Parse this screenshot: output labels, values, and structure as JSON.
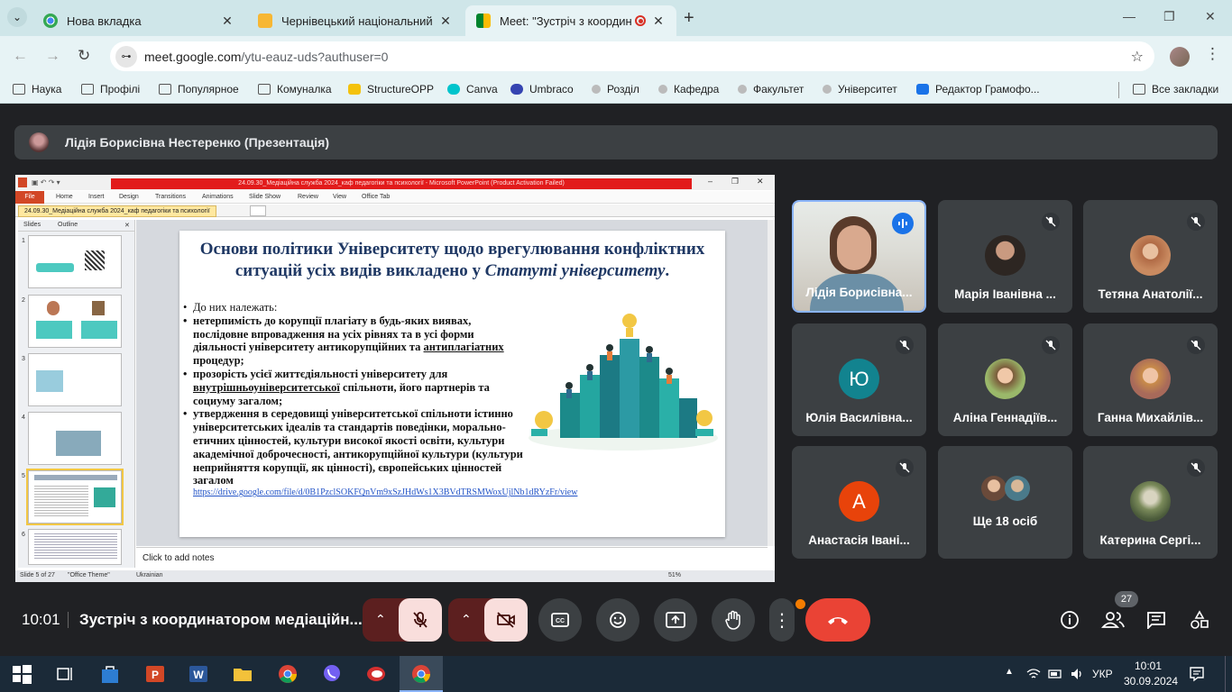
{
  "browser": {
    "tabs": [
      {
        "title": "Нова вкладка"
      },
      {
        "title": "Чернівецький національний у"
      },
      {
        "title": "Meet: \"Зустріч з координат"
      }
    ],
    "url_main": "meet.google.com",
    "url_path": "/ytu-eauz-uds?authuser=0",
    "bookmarks": [
      "Наука",
      "Профілі",
      "Популярное",
      "Комуналка",
      "StructureOPP",
      "Canva",
      "Umbraco",
      "Розділ",
      "Кафедра",
      "Факультет",
      "Університет",
      "Редактор Грамофо...",
      "Все закладки"
    ]
  },
  "meet": {
    "presenter": "Лідія Борисівна Нестеренко (Презентація)",
    "participants": [
      {
        "name": "Лідія Борисівна...",
        "speaking": true
      },
      {
        "name": "Марія Іванівна ..."
      },
      {
        "name": "Тетяна Анатолії..."
      },
      {
        "name": "Юлія Василівна...",
        "initial": "Ю"
      },
      {
        "name": "Аліна Геннадіїв..."
      },
      {
        "name": "Ганна Михайлів..."
      },
      {
        "name": "Анастасія Івані...",
        "initial": "А"
      },
      {
        "name": "Ще 18 осіб"
      },
      {
        "name": "Катерина Сергі..."
      }
    ],
    "time": "10:01",
    "meeting_title": "Зустріч з координатором медіаційн...",
    "participant_count": "27"
  },
  "ppt": {
    "window_title": "24.09.30_Медіаційна служба 2024_каф педагогіки та психології - Microsoft PowerPoint (Product Activation Failed)",
    "ribbon_tabs": [
      "File",
      "Home",
      "Insert",
      "Design",
      "Transitions",
      "Animations",
      "Slide Show",
      "Review",
      "View",
      "Office Tab"
    ],
    "doc_tab": "24.09.30_Медіаційна служба 2024_каф педагогіки та психології",
    "side_tabs": [
      "Slides",
      "Outline"
    ],
    "slide_numbers": [
      "1",
      "2",
      "3",
      "4",
      "5",
      "6"
    ],
    "slide_title_a": "Основи політики Університету щодо врегулювання конфліктних ситуацій усіх видів викладено у ",
    "slide_title_b": "Статуті університету",
    "slide_title_c": ".",
    "intro": "До них належать:",
    "item1_a": "нетерпимість до корупції плагіату в будь-яких виявах, послідовне впровадження на усіх рівнях та в усі форми діяльності університету антикорупційних та ",
    "item1_u": "антиплагіатних",
    "item1_b": " процедур;",
    "item2_a": "прозорість усієї життєдіяльності університету для ",
    "item2_u": "внутрішньоуніверситетської",
    "item2_b": " спільноти, його партнерів та социуму загалом;",
    "item3": "утвердження в середовищі університетської спільноти істинно університетських ідеалів та стандартів поведінки, морально-етичних цінностей, культури високої якості освіти, культури академічної доброчесності, антикорупційної культури (культури неприйняття корупції, як цінності), європейських цінностей загалом",
    "link": "https://drive.google.com/file/d/0B1PzclSOKFQnVm9xSzJHdWs1X3BVdTRSMWoxUjlNb1dRYzFr/view",
    "notes": "Click to add notes",
    "status_slide": "Slide 5 of 27",
    "status_theme": "\"Office Theme\"",
    "status_lang": "Ukrainian",
    "zoom": "51%"
  },
  "taskbar": {
    "lang": "УКР",
    "time": "10:01",
    "date": "30.09.2024"
  }
}
